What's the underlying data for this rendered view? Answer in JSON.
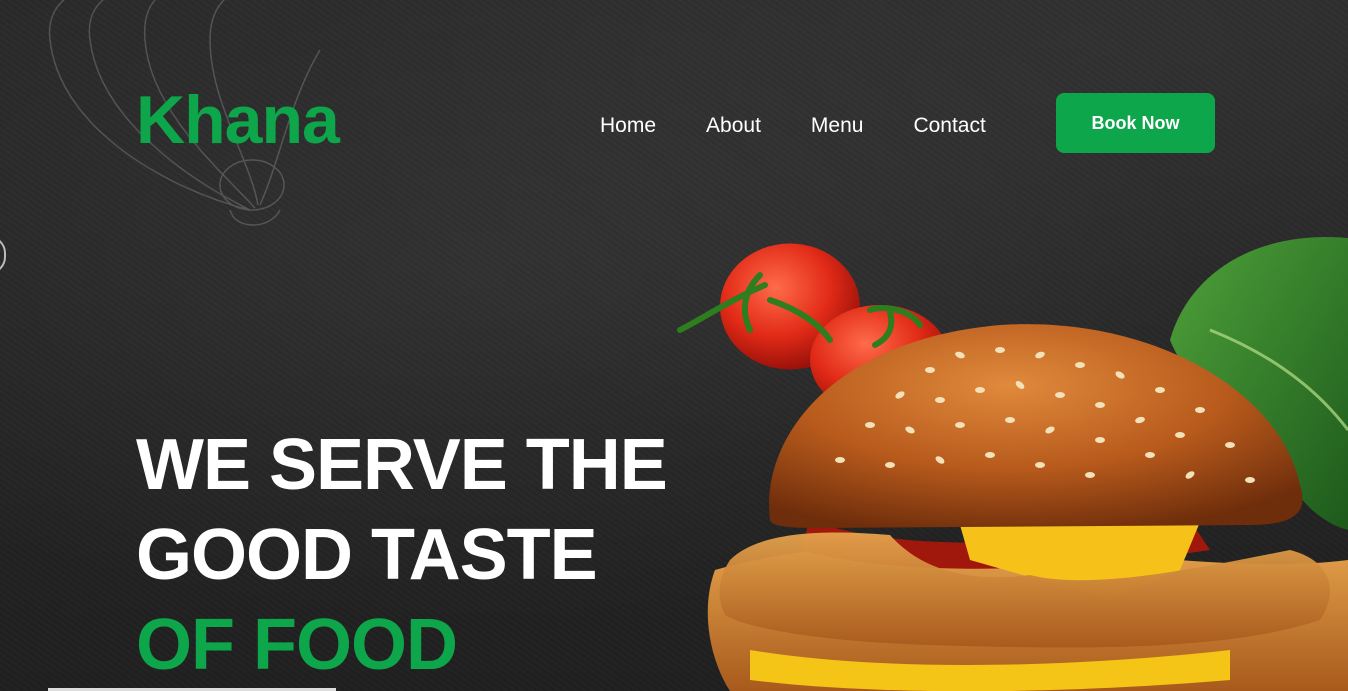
{
  "brand": {
    "name": "Khana",
    "color": "#0ea64b"
  },
  "nav": {
    "items": [
      {
        "label": "Home"
      },
      {
        "label": "About"
      },
      {
        "label": "Menu"
      },
      {
        "label": "Contact"
      }
    ],
    "cta_label": "Book Now"
  },
  "hero": {
    "line1": "WE SERVE THE",
    "line2": "GOOD TASTE",
    "line3": "OF FOOD"
  },
  "colors": {
    "accent": "#0ea64b",
    "background": "#262626",
    "text": "#ffffff"
  },
  "images": {
    "hero_image": "burger-with-tomatoes-and-lettuce",
    "background_sketch": "onion-sketch"
  }
}
